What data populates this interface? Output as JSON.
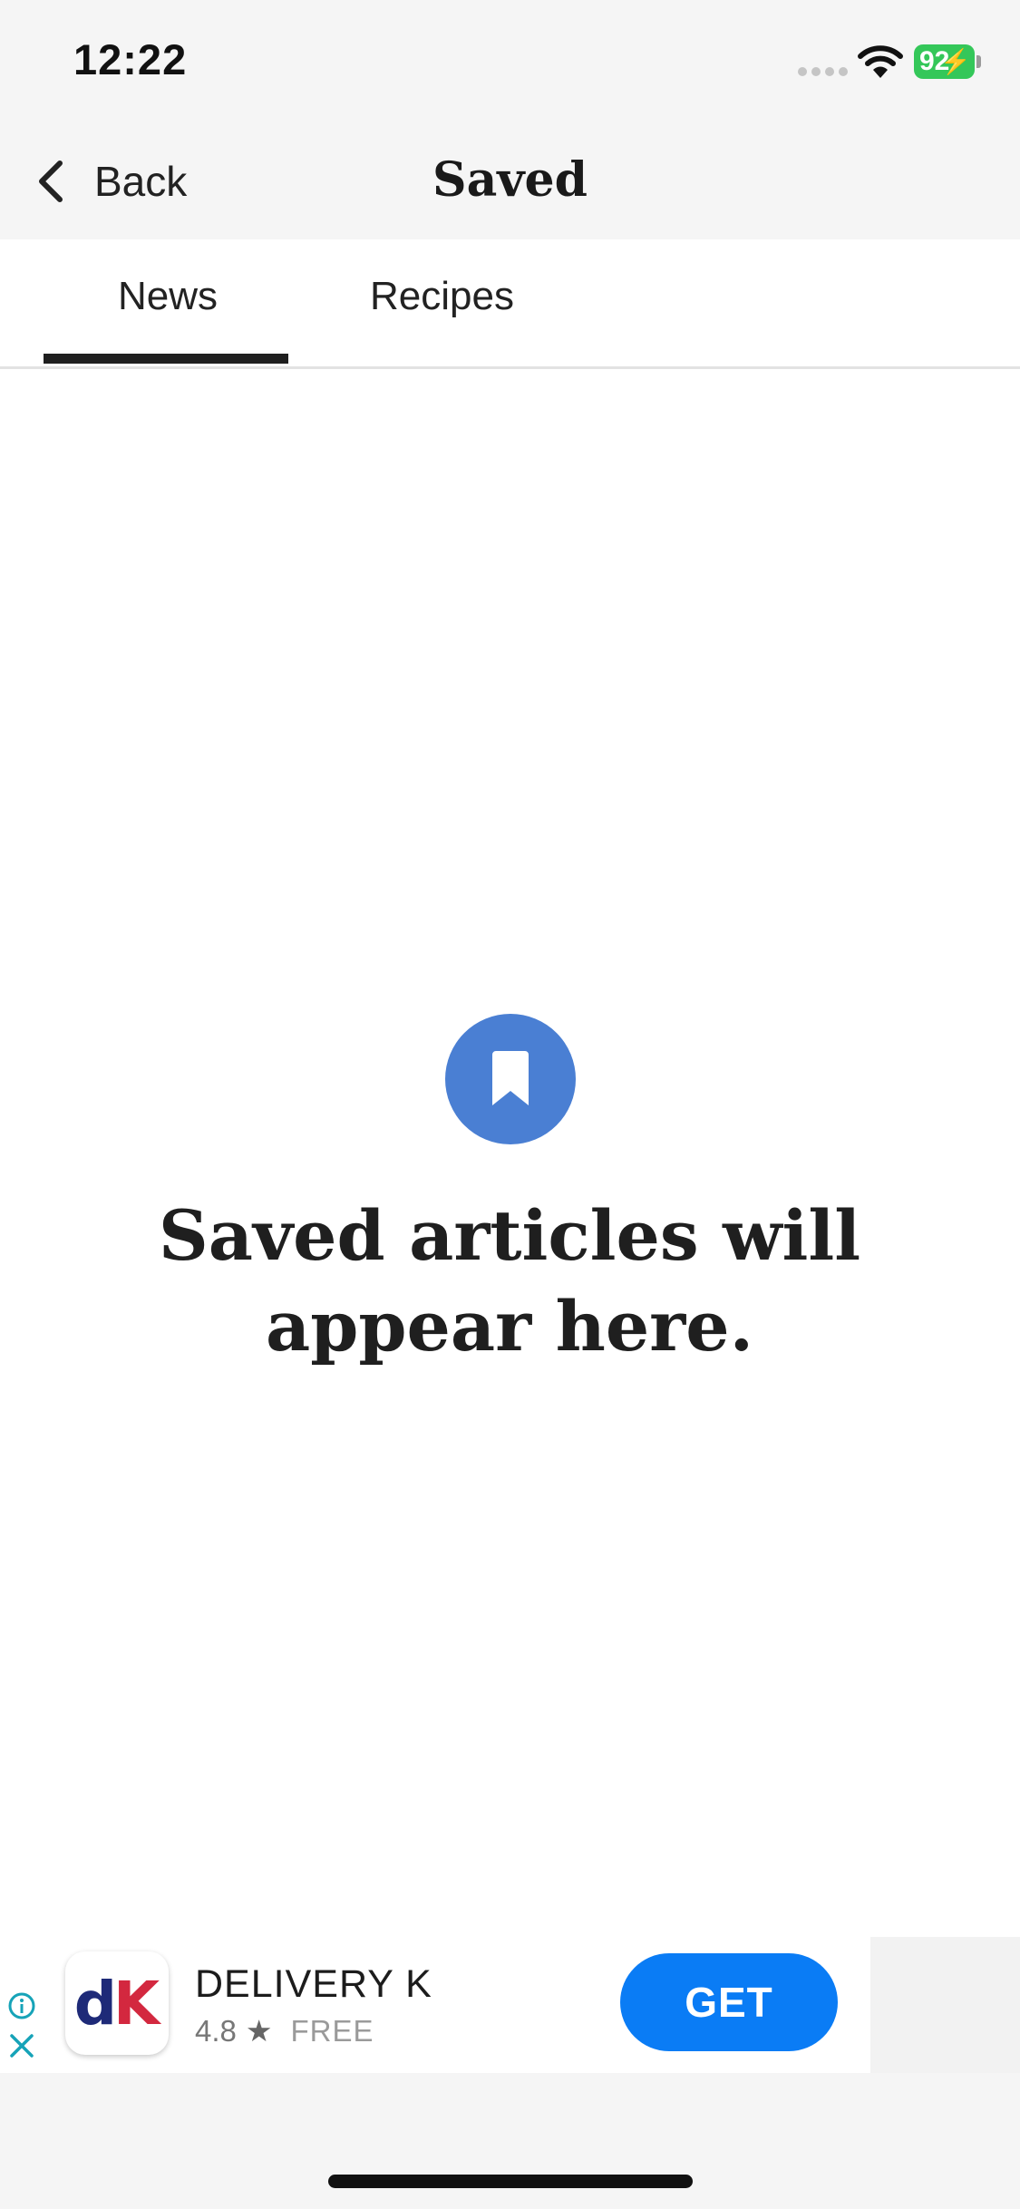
{
  "status_bar": {
    "time": "12:22",
    "battery": "92"
  },
  "nav": {
    "back_label": "Back",
    "title": "Saved"
  },
  "tabs": [
    {
      "label": "News",
      "selected": true
    },
    {
      "label": "Recipes",
      "selected": false
    }
  ],
  "empty_state": {
    "icon": "bookmark-icon",
    "message": "Saved articles will appear here."
  },
  "ad": {
    "app_name": "DELIVERY K",
    "rating": "4.8",
    "price": "FREE",
    "cta": "GET",
    "icon_letters": {
      "first": "d",
      "second": "K"
    }
  },
  "colors": {
    "accent": "#4a7fd3",
    "cta": "#0a7cf5",
    "battery": "#34c759",
    "ad_icons": "#16a3b8"
  }
}
